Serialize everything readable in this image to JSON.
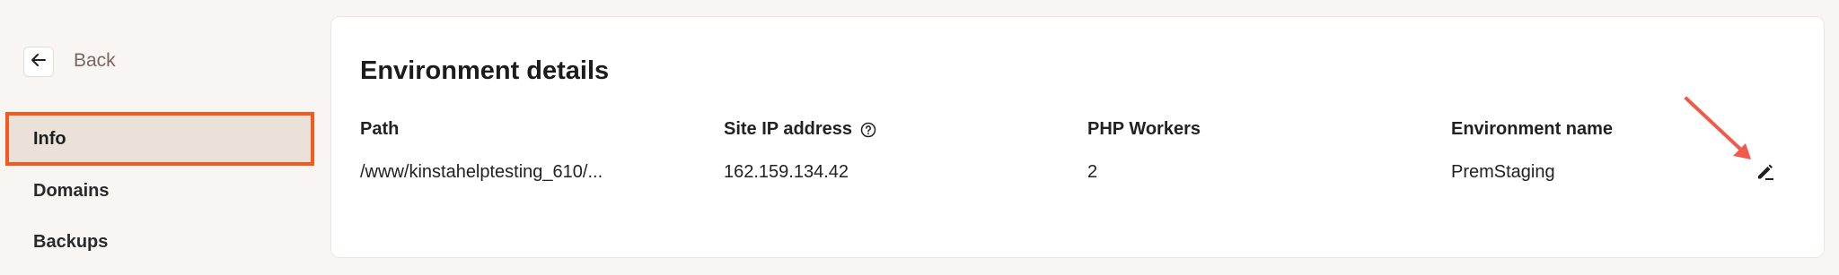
{
  "sidebar": {
    "back_label": "Back",
    "items": [
      {
        "label": "Info",
        "active": true
      },
      {
        "label": "Domains",
        "active": false
      },
      {
        "label": "Backups",
        "active": false
      }
    ]
  },
  "card": {
    "title": "Environment details",
    "columns": [
      {
        "header": "Path",
        "value": "/www/kinstahelptesting_610/..."
      },
      {
        "header": "Site IP address",
        "value": "162.159.134.42"
      },
      {
        "header": "PHP Workers",
        "value": "2"
      },
      {
        "header": "Environment name",
        "value": "PremStaging"
      }
    ]
  },
  "icons": {
    "back": "arrow-left-icon",
    "help": "question-circle-icon",
    "edit": "pencil-icon"
  },
  "colors": {
    "highlight": "#f25a1e",
    "annotation_arrow": "#f05a4a",
    "active_item_bg": "#eae1d9",
    "page_bg": "#f8f5f2"
  }
}
